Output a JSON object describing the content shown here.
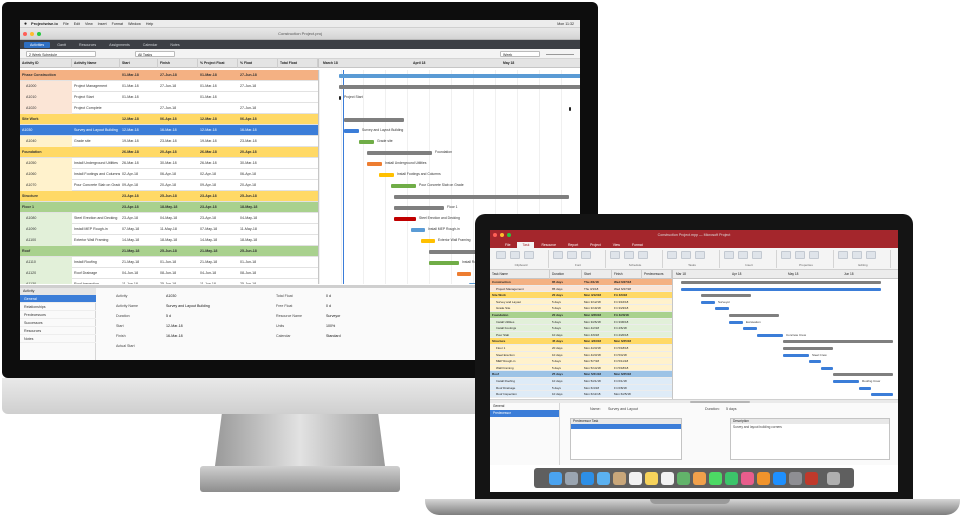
{
  "imac_app": {
    "menu": {
      "app_name": "Projectwise.io",
      "items": [
        "File",
        "Edit",
        "View",
        "Insert",
        "Format",
        "Window",
        "Help"
      ],
      "status": "Mon 11:32"
    },
    "window_title": "Construction Project.proj",
    "view_tabs": [
      "Activities",
      "Gantt",
      "Resources",
      "Assignments",
      "Calendar",
      "Notes"
    ],
    "toolbar": {
      "view_select": "2 Week Schedule",
      "filter_select": "All Tasks",
      "zoom_select": "Week"
    },
    "columns": [
      "Activity ID",
      "Activity Name",
      "Start",
      "Finish",
      "% Project Float",
      "% Float",
      "Total Float"
    ],
    "timescale_months": [
      "March 18",
      "April 18",
      "May 18"
    ],
    "rows": [
      {
        "id": "Phase Construction",
        "name": "",
        "start": "01-Mar-18",
        "finish": "27-Jun-18",
        "f1": "01-Mar-18",
        "f2": "27-Jun-18",
        "f3": "",
        "kind": "group-orange"
      },
      {
        "id": "A1000",
        "name": "Project Management",
        "start": "01-Mar-18",
        "finish": "27-Jun-18",
        "f1": "01-Mar-18",
        "f2": "27-Jun-18",
        "f3": "",
        "kind": "sub-orange"
      },
      {
        "id": "A1010",
        "name": "Project Start",
        "start": "01-Mar-18",
        "finish": "",
        "f1": "01-Mar-18",
        "f2": "",
        "f3": "",
        "kind": "sub-orange"
      },
      {
        "id": "A1020",
        "name": "Project Complete",
        "start": "",
        "finish": "27-Jun-18",
        "f1": "",
        "f2": "27-Jun-18",
        "f3": "",
        "kind": "sub-orange"
      },
      {
        "id": "Site Work",
        "name": "",
        "start": "12-Mar-18",
        "finish": "06-Apr-18",
        "f1": "12-Mar-18",
        "f2": "06-Apr-18",
        "f3": "",
        "kind": "group-yellow"
      },
      {
        "id": "A1030",
        "name": "Survey and Layout Building",
        "start": "12-Mar-18",
        "finish": "16-Mar-18",
        "f1": "12-Mar-18",
        "f2": "16-Mar-18",
        "f3": "",
        "kind": "selected"
      },
      {
        "id": "A1040",
        "name": "Grade site",
        "start": "19-Mar-18",
        "finish": "23-Mar-18",
        "f1": "19-Mar-18",
        "f2": "23-Mar-18",
        "f3": "",
        "kind": "sub-yellow"
      },
      {
        "id": "Foundation",
        "name": "",
        "start": "26-Mar-18",
        "finish": "20-Apr-18",
        "f1": "26-Mar-18",
        "f2": "20-Apr-18",
        "f3": "",
        "kind": "group-yellow"
      },
      {
        "id": "A1050",
        "name": "Install Underground Utilities",
        "start": "26-Mar-18",
        "finish": "30-Mar-18",
        "f1": "26-Mar-18",
        "f2": "30-Mar-18",
        "f3": "",
        "kind": "sub-yellow"
      },
      {
        "id": "A1060",
        "name": "Install Footings and Columns",
        "start": "02-Apr-18",
        "finish": "06-Apr-18",
        "f1": "02-Apr-18",
        "f2": "06-Apr-18",
        "f3": "",
        "kind": "sub-yellow"
      },
      {
        "id": "A1070",
        "name": "Pour Concrete Slab on Grade",
        "start": "09-Apr-18",
        "finish": "20-Apr-18",
        "f1": "09-Apr-18",
        "f2": "20-Apr-18",
        "f3": "",
        "kind": "sub-yellow"
      },
      {
        "id": "Structure",
        "name": "",
        "start": "23-Apr-18",
        "finish": "25-Jun-18",
        "f1": "23-Apr-18",
        "f2": "25-Jun-18",
        "f3": "",
        "kind": "group-yellow"
      },
      {
        "id": "Floor 1",
        "name": "",
        "start": "23-Apr-18",
        "finish": "18-May-18",
        "f1": "23-Apr-18",
        "f2": "18-May-18",
        "f3": "",
        "kind": "group-green"
      },
      {
        "id": "A1080",
        "name": "Steel Erection and Decking",
        "start": "23-Apr-18",
        "finish": "04-May-18",
        "f1": "23-Apr-18",
        "f2": "04-May-18",
        "f3": "",
        "kind": "sub-green"
      },
      {
        "id": "A1090",
        "name": "Install MEP Rough-in",
        "start": "07-May-18",
        "finish": "11-May-18",
        "f1": "07-May-18",
        "f2": "11-May-18",
        "f3": "",
        "kind": "sub-green"
      },
      {
        "id": "A1100",
        "name": "Exterior Wall Framing",
        "start": "14-May-18",
        "finish": "18-May-18",
        "f1": "14-May-18",
        "f2": "18-May-18",
        "f3": "",
        "kind": "sub-green"
      },
      {
        "id": "Roof",
        "name": "",
        "start": "21-May-18",
        "finish": "25-Jun-18",
        "f1": "21-May-18",
        "f2": "25-Jun-18",
        "f3": "",
        "kind": "group-green"
      },
      {
        "id": "A1110",
        "name": "Install Roofing",
        "start": "21-May-18",
        "finish": "01-Jun-18",
        "f1": "21-May-18",
        "f2": "01-Jun-18",
        "f3": "",
        "kind": "sub-green"
      },
      {
        "id": "A1120",
        "name": "Roof Drainage",
        "start": "04-Jun-18",
        "finish": "08-Jun-18",
        "f1": "04-Jun-18",
        "f2": "08-Jun-18",
        "f3": "",
        "kind": "sub-green"
      },
      {
        "id": "A1130",
        "name": "Roof Inspection",
        "start": "11-Jun-18",
        "finish": "25-Jun-18",
        "f1": "11-Jun-18",
        "f2": "25-Jun-18",
        "f3": "",
        "kind": "sub-green"
      }
    ],
    "gantt_labels": [
      "Project Start",
      "Survey and Layout Building",
      "Grade site",
      "Foundation",
      "Install Underground Utilities",
      "Install Footings and Columns",
      "Pour Concrete Slab on Grade",
      "Floor 1",
      "Steel Erection and Decking",
      "Install MEP Rough-in",
      "Exterior Wall Framing",
      "Roof",
      "Install Roofing"
    ],
    "inspector": {
      "header": "Activity",
      "items": [
        "General",
        "Relationships",
        "Predecessors",
        "Successors",
        "Resources",
        "Notes"
      ],
      "fields": [
        {
          "label": "Activity",
          "value": "A1030"
        },
        {
          "label": "Activity Name",
          "value": "Survey and Layout Building"
        },
        {
          "label": "Duration",
          "value": "5 d"
        },
        {
          "label": "Start",
          "value": "12-Mar-18"
        },
        {
          "label": "Finish",
          "value": "16-Mar-18"
        },
        {
          "label": "Actual Start",
          "value": ""
        },
        {
          "label": "Total Float",
          "value": "0 d"
        },
        {
          "label": "Free Float",
          "value": "0 d"
        },
        {
          "label": "Resource Name",
          "value": "Surveyor"
        },
        {
          "label": "Units",
          "value": "100%"
        },
        {
          "label": "Calendar",
          "value": "Standard"
        }
      ]
    }
  },
  "laptop_app": {
    "title": "Construction Project.mpp — Microsoft Project",
    "ribbon_tabs": [
      "File",
      "Task",
      "Resource",
      "Report",
      "Project",
      "View",
      "Format"
    ],
    "ribbon_groups": [
      "Clipboard",
      "Font",
      "Schedule",
      "Tasks",
      "Insert",
      "Properties",
      "Editing"
    ],
    "columns": [
      "Task Name",
      "Duration",
      "Start",
      "Finish",
      "Predecessors"
    ],
    "timescale_months": [
      "Mar 18",
      "Apr 18",
      "May 18",
      "Jun 18"
    ],
    "rows": [
      {
        "name": "Construction",
        "dur": "85 days",
        "start": "Thu 3/1/18",
        "finish": "Wed 6/27/18",
        "kind": "group-orange"
      },
      {
        "name": "Project Management",
        "dur": "85 days",
        "start": "Thu 3/1/18",
        "finish": "Wed 6/27/18",
        "kind": "sub-orange"
      },
      {
        "name": "Site Work",
        "dur": "20 days",
        "start": "Mon 3/12/18",
        "finish": "Fri 4/6/18",
        "kind": "group-yellow"
      },
      {
        "name": "Survey and Layout",
        "dur": "5 days",
        "start": "Mon 3/12/18",
        "finish": "Fri 3/16/18",
        "kind": "sub-yellow"
      },
      {
        "name": "Grade Site",
        "dur": "5 days",
        "start": "Mon 3/19/18",
        "finish": "Fri 3/23/18",
        "kind": "sub-yellow"
      },
      {
        "name": "Foundation",
        "dur": "20 days",
        "start": "Mon 3/26/18",
        "finish": "Fri 4/20/18",
        "kind": "group-green"
      },
      {
        "name": "Install Utilities",
        "dur": "5 days",
        "start": "Mon 3/26/18",
        "finish": "Fri 3/30/18",
        "kind": "sub-green"
      },
      {
        "name": "Install Footings",
        "dur": "5 days",
        "start": "Mon 4/2/18",
        "finish": "Fri 4/6/18",
        "kind": "sub-green"
      },
      {
        "name": "Pour Slab",
        "dur": "10 days",
        "start": "Mon 4/9/18",
        "finish": "Fri 4/20/18",
        "kind": "sub-green"
      },
      {
        "name": "Structure",
        "dur": "45 days",
        "start": "Mon 4/23/18",
        "finish": "Mon 6/25/18",
        "kind": "group-yellow"
      },
      {
        "name": "Floor 1",
        "dur": "20 days",
        "start": "Mon 4/23/18",
        "finish": "Fri 5/18/18",
        "kind": "sub-yellow"
      },
      {
        "name": "Steel Erection",
        "dur": "10 days",
        "start": "Mon 4/23/18",
        "finish": "Fri 5/4/18",
        "kind": "sub-yellow"
      },
      {
        "name": "MEP Rough-in",
        "dur": "5 days",
        "start": "Mon 5/7/18",
        "finish": "Fri 5/11/18",
        "kind": "sub-yellow"
      },
      {
        "name": "Wall Framing",
        "dur": "5 days",
        "start": "Mon 5/14/18",
        "finish": "Fri 5/18/18",
        "kind": "sub-yellow"
      },
      {
        "name": "Roof",
        "dur": "25 days",
        "start": "Mon 5/21/18",
        "finish": "Mon 6/25/18",
        "kind": "group-blue"
      },
      {
        "name": "Install Roofing",
        "dur": "10 days",
        "start": "Mon 5/21/18",
        "finish": "Fri 6/1/18",
        "kind": "sub-blue"
      },
      {
        "name": "Roof Drainage",
        "dur": "5 days",
        "start": "Mon 6/4/18",
        "finish": "Fri 6/8/18",
        "kind": "sub-blue"
      },
      {
        "name": "Roof Inspection",
        "dur": "10 days",
        "start": "Mon 6/11/18",
        "finish": "Mon 6/25/18",
        "kind": "sub-blue"
      }
    ],
    "gantt_labels": [
      "Surveyor",
      "Excavation",
      "Concrete Crew",
      "Steel Crew",
      "Roofing Crew"
    ],
    "form": {
      "side_items": [
        "General",
        "Predecessor"
      ],
      "name_label": "Name:",
      "name_value": "Survey and Layout",
      "duration_label": "Duration:",
      "duration_value": "5 days",
      "pred_header": "Predecessor Task",
      "notes_header": "Description",
      "notes_value": "Survey and layout building corners"
    }
  },
  "dock_icons": [
    "finder-icon",
    "launchpad-icon",
    "safari-icon",
    "mail-icon",
    "contacts-icon",
    "calendar-icon",
    "notes-icon",
    "reminders-icon",
    "maps-icon",
    "photos-icon",
    "messages-icon",
    "facetime-icon",
    "itunes-icon",
    "ibooks-icon",
    "appstore-icon",
    "preferences-icon",
    "project-app-icon",
    "trash-icon"
  ]
}
